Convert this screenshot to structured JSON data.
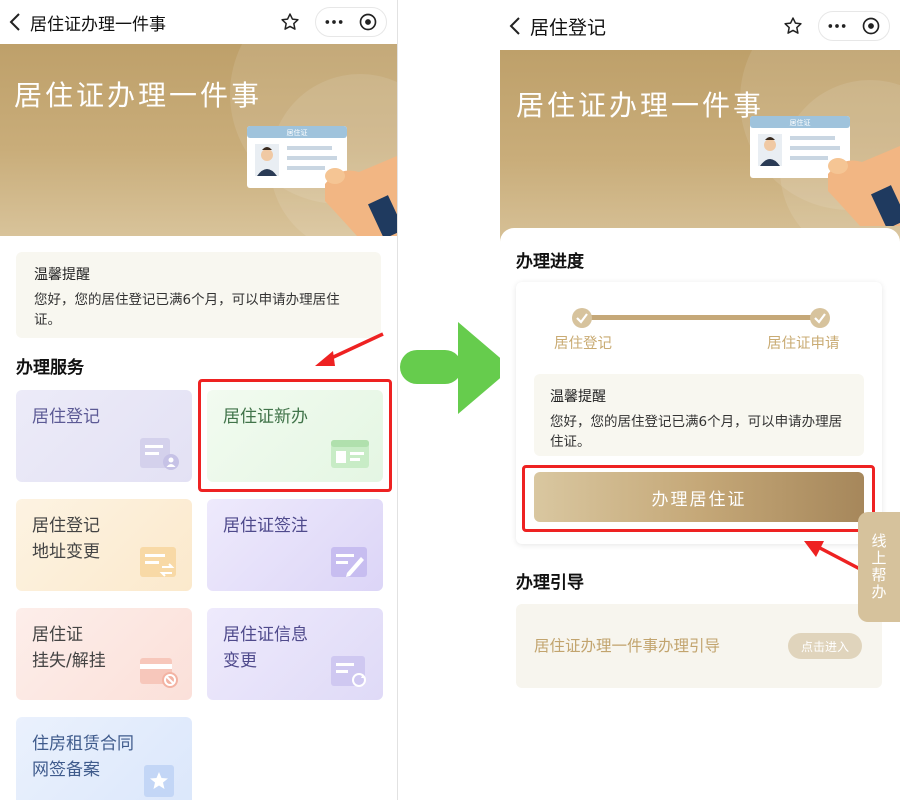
{
  "left_screen": {
    "nav_title": "居住证办理一件事",
    "banner_title": "居住证办理一件事",
    "card_title": "居住证",
    "tip": {
      "title": "温馨提醒",
      "text": "您好，您的居住登记已满6个月，可以申请办理居住证。"
    },
    "section_title": "办理服务",
    "services": [
      {
        "label": "居住登记",
        "icon": "document-user-icon"
      },
      {
        "label": "居住证新办",
        "icon": "id-card-icon"
      },
      {
        "label": "居住登记\n地址变更",
        "icon": "address-change-icon"
      },
      {
        "label": "居住证签注",
        "icon": "edit-document-icon"
      },
      {
        "label": "居住证\n挂失/解挂",
        "icon": "card-block-icon"
      },
      {
        "label": "居住证信息\n变更",
        "icon": "refresh-document-icon"
      },
      {
        "label": "住房租赁合同\n网签备案",
        "icon": "contract-star-icon"
      }
    ]
  },
  "right_screen": {
    "nav_title": "居住登记",
    "banner_title": "居住证办理一件事",
    "card_title": "居住证",
    "progress_title": "办理进度",
    "steps": [
      "居住登记",
      "居住证申请"
    ],
    "tip": {
      "title": "温馨提醒",
      "text": "您好，您的居住登记已满6个月，可以申请办理居住证。"
    },
    "apply_button": "办理居住证",
    "guide_title": "办理引导",
    "guide_item": "居住证办理一件事办理引导",
    "guide_button": "点击进入",
    "float_help": "线上帮办"
  },
  "colors": {
    "gold": "#c5a878",
    "red_annotation": "#ee2222",
    "green_arrow": "#66cc4d"
  }
}
